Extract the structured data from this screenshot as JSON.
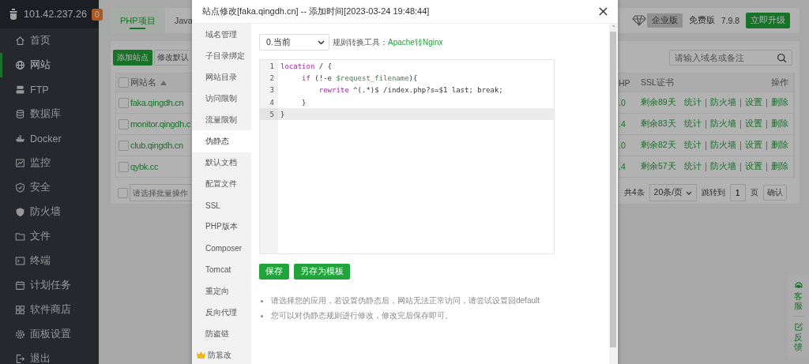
{
  "sidebar": {
    "host": "101.42.237.26",
    "badge": "0",
    "items": [
      {
        "label": "首页",
        "selected": false
      },
      {
        "label": "网站",
        "selected": true
      },
      {
        "label": "FTP",
        "selected": false
      },
      {
        "label": "数据库",
        "selected": false
      },
      {
        "label": "Docker",
        "selected": false
      },
      {
        "label": "监控",
        "selected": false
      },
      {
        "label": "安全",
        "selected": false
      },
      {
        "label": "防火墙",
        "selected": false
      },
      {
        "label": "文件",
        "selected": false
      },
      {
        "label": "终端",
        "selected": false
      },
      {
        "label": "计划任务",
        "selected": false
      },
      {
        "label": "软件商店",
        "selected": false
      },
      {
        "label": "面板设置",
        "selected": false
      },
      {
        "label": "退出",
        "selected": false
      }
    ]
  },
  "top_bar": {
    "tabs": [
      {
        "label": "PHP项目",
        "selected": true
      },
      {
        "label": "Java",
        "selected": false
      }
    ],
    "edition_badge": "企业版",
    "edition": "免费版",
    "version": "7.9.8",
    "upgrade_button": "立即升级"
  },
  "site_list": {
    "add_button": "添加站点",
    "default_page_button": "修改默认",
    "search": {
      "placeholder": "请输入域名或备注"
    },
    "header": {
      "checked": false,
      "name": "网站名",
      "php": "HP",
      "ssl": "SSL证书",
      "actions": "操作"
    },
    "rows": [
      {
        "checked": false,
        "name": "faka.qingdh.cn",
        "php": ".0",
        "ssl": "剩余89天",
        "actions": [
          "统计",
          "防火墙",
          "设置",
          "删除"
        ]
      },
      {
        "checked": false,
        "name": "monitor.qingdh.c",
        "php": ".4",
        "ssl": "剩余83天",
        "actions": [
          "统计",
          "防火墙",
          "设置",
          "删除"
        ]
      },
      {
        "checked": false,
        "name": "club.qingdh.cn",
        "php": ".0",
        "ssl": "剩余82天",
        "actions": [
          "统计",
          "防火墙",
          "设置",
          "删除"
        ]
      },
      {
        "checked": false,
        "name": "qybk.cc",
        "php": ".4",
        "ssl": "剩余57天",
        "actions": [
          "统计",
          "防火墙",
          "设置",
          "删除"
        ]
      }
    ],
    "batch": {
      "checked": false,
      "placeholder": "请选择批量操作"
    },
    "pagination": {
      "total": "共4条",
      "page_size": "20条/页",
      "jump_label": "跳转到",
      "page": "1",
      "page_unit": "页",
      "confirm_button": "确认"
    }
  },
  "float_widget": [
    {
      "label": "客服"
    },
    {
      "label": "反馈"
    }
  ],
  "modal": {
    "title": "站点修改[faka.qingdh.cn] -- 添加时间[2023-03-24 19:48:44]",
    "menu": [
      {
        "label": "域名管理",
        "kind": "plain",
        "selected": false
      },
      {
        "label": "子目录绑定",
        "kind": "plain",
        "selected": false
      },
      {
        "label": "网站目录",
        "kind": "plain",
        "selected": false
      },
      {
        "label": "访问限制",
        "kind": "plain",
        "selected": false
      },
      {
        "label": "流量限制",
        "kind": "plain",
        "selected": false
      },
      {
        "label": "伪静态",
        "kind": "plain",
        "selected": true
      },
      {
        "label": "默认文档",
        "kind": "plain",
        "selected": false
      },
      {
        "label": "配置文件",
        "kind": "plain",
        "selected": false
      },
      {
        "label": "SSL",
        "kind": "plain",
        "selected": false
      },
      {
        "label": "PHP版本",
        "kind": "plain",
        "selected": false
      },
      {
        "label": "Composer",
        "kind": "plain",
        "selected": false
      },
      {
        "label": "Tomcat",
        "kind": "plain",
        "selected": false
      },
      {
        "label": "重定向",
        "kind": "plain",
        "selected": false
      },
      {
        "label": "反向代理",
        "kind": "plain",
        "selected": false
      },
      {
        "label": "防盗链",
        "kind": "plain",
        "selected": false
      },
      {
        "label": "防篡改",
        "kind": "pro",
        "selected": false
      }
    ],
    "rewrite": {
      "template": "0.当前",
      "converter_label": "规则转换工具：",
      "converter_link": "Apache转Nginx",
      "code": [
        {
          "number": "1",
          "active": false,
          "tokens": [
            {
              "kind": "keyword",
              "text": "location"
            },
            {
              "kind": "plain",
              "text": " / {"
            }
          ]
        },
        {
          "number": "2",
          "active": false,
          "tokens": [
            {
              "kind": "keyword",
              "text": "     if"
            },
            {
              "kind": "plain",
              "text": " (!-e "
            },
            {
              "kind": "variable",
              "text": "$request_filename"
            },
            {
              "kind": "plain",
              "text": "){"
            }
          ]
        },
        {
          "number": "3",
          "active": false,
          "tokens": [
            {
              "kind": "keyword",
              "text": "         rewrite"
            },
            {
              "kind": "plain",
              "text": " ^(.*)$ /index.php?s=$1 last; break;"
            }
          ]
        },
        {
          "number": "4",
          "active": false,
          "tokens": [
            {
              "kind": "plain",
              "text": "     }"
            }
          ]
        },
        {
          "number": "5",
          "active": true,
          "tokens": [
            {
              "kind": "plain",
              "text": "}"
            }
          ]
        }
      ],
      "buttons": [
        "保存",
        "另存为模板"
      ],
      "notes": [
        "请选择您的应用，若设置伪静态后，网站无法正常访问，请尝试设置回default",
        "您可以对伪静态规则进行修改，修改完后保存即可。"
      ]
    }
  }
}
